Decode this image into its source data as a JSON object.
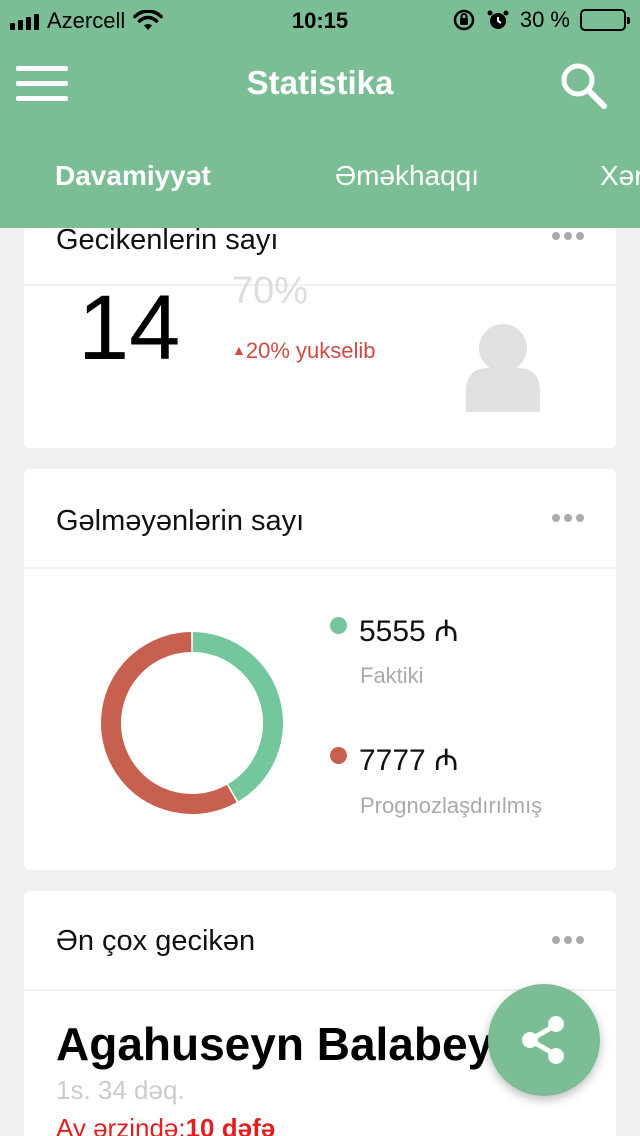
{
  "status_bar": {
    "carrier": "Azercell",
    "time": "10:15",
    "battery": "30 %",
    "battery_level": 0.3
  },
  "header": {
    "title": "Statistika",
    "tabs": [
      {
        "label": "Davamiyyət",
        "active": true
      },
      {
        "label": "Əməkhaqqı",
        "active": false
      },
      {
        "label": "Xər",
        "active": false
      }
    ]
  },
  "late_card": {
    "title": "Gecikenlerin sayı",
    "count": "14",
    "percent": "70%",
    "trend": "20% yukselib"
  },
  "absent_card": {
    "title": "Gəlməyənlərin sayı",
    "legend": [
      {
        "value": "5555 ₼",
        "label": "Faktiki",
        "color": "#74c69d"
      },
      {
        "value": "7777 ₼",
        "label": "Prognozlaşdırılmış",
        "color": "#c8604f"
      }
    ]
  },
  "chart_data": {
    "type": "pie",
    "categories": [
      "Faktiki",
      "Prognozlaşdırılmış"
    ],
    "values": [
      5555,
      7777
    ],
    "donut": true,
    "colors": [
      "#74c69d",
      "#c8604f"
    ]
  },
  "most_late_card": {
    "title": "Ən çox gecikən",
    "name": "Agahuseyn Balabeyli",
    "time": "1s. 34 dəq.",
    "frequency_label": "Ay ərzində:",
    "frequency_value": "10 dəfə"
  },
  "colors": {
    "primary": "#7bbd95",
    "accent_red": "#cf4b44",
    "background": "#f0f0f0"
  }
}
